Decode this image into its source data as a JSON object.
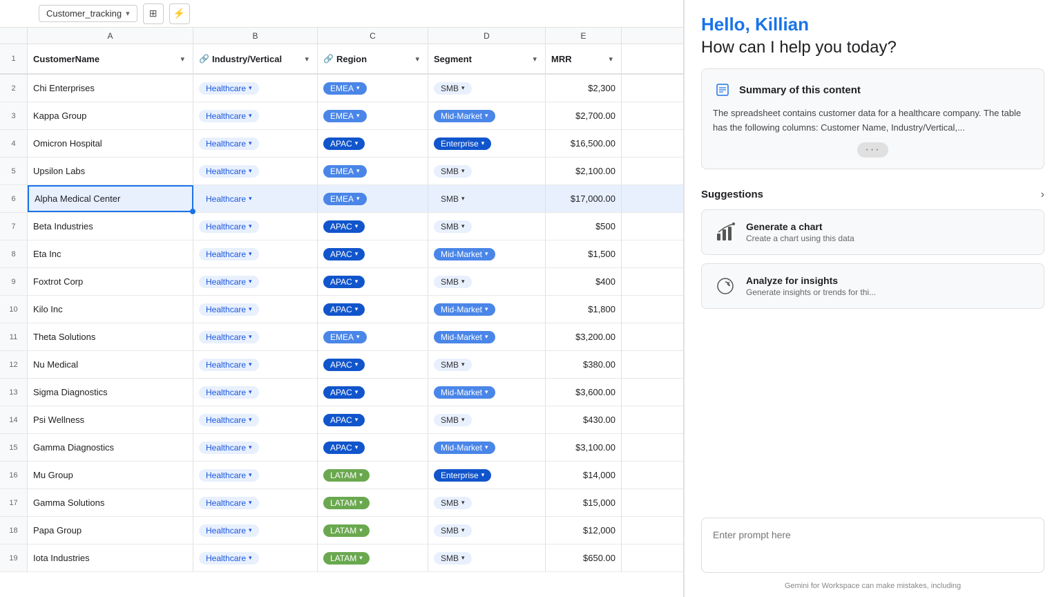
{
  "spreadsheet": {
    "sheet_name": "Customer_tracking",
    "columns": {
      "a": "A",
      "b": "B",
      "c": "C",
      "d": "D",
      "e": "E"
    },
    "headers": {
      "customer_name": "CustomerName",
      "industry": "Industry/Vertical",
      "region": "Region",
      "segment": "Segment",
      "mrr": "MRR"
    },
    "rows": [
      {
        "num": 2,
        "name": "Chi Enterprises",
        "industry": "Healthcare",
        "region": "EMEA",
        "region_type": "emea",
        "segment": "SMB",
        "segment_type": "smb",
        "mrr": "$2,300",
        "selected": false
      },
      {
        "num": 3,
        "name": "Kappa Group",
        "industry": "Healthcare",
        "region": "EMEA",
        "region_type": "emea",
        "segment": "Mid-Market",
        "segment_type": "midmarket",
        "mrr": "$2,700.00",
        "selected": false
      },
      {
        "num": 4,
        "name": "Omicron Hospital",
        "industry": "Healthcare",
        "region": "APAC",
        "region_type": "apac",
        "segment": "Enterprise",
        "segment_type": "enterprise",
        "mrr": "$16,500.00",
        "selected": false
      },
      {
        "num": 5,
        "name": "Upsilon Labs",
        "industry": "Healthcare",
        "region": "EMEA",
        "region_type": "emea",
        "segment": "SMB",
        "segment_type": "smb",
        "mrr": "$2,100.00",
        "selected": false
      },
      {
        "num": 6,
        "name": "Alpha Medical Center",
        "industry": "Healthcare",
        "region": "EMEA",
        "region_type": "emea",
        "segment": "SMB",
        "segment_type": "smb",
        "mrr": "$17,000.00",
        "selected": true
      },
      {
        "num": 7,
        "name": "Beta Industries",
        "industry": "Healthcare",
        "region": "APAC",
        "region_type": "apac",
        "segment": "SMB",
        "segment_type": "smb",
        "mrr": "$500",
        "selected": false
      },
      {
        "num": 8,
        "name": "Eta Inc",
        "industry": "Healthcare",
        "region": "APAC",
        "region_type": "apac",
        "segment": "Mid-Market",
        "segment_type": "midmarket",
        "mrr": "$1,500",
        "selected": false
      },
      {
        "num": 9,
        "name": "Foxtrot Corp",
        "industry": "Healthcare",
        "region": "APAC",
        "region_type": "apac",
        "segment": "SMB",
        "segment_type": "smb",
        "mrr": "$400",
        "selected": false
      },
      {
        "num": 10,
        "name": "Kilo Inc",
        "industry": "Healthcare",
        "region": "APAC",
        "region_type": "apac",
        "segment": "Mid-Market",
        "segment_type": "midmarket",
        "mrr": "$1,800",
        "selected": false
      },
      {
        "num": 11,
        "name": "Theta Solutions",
        "industry": "Healthcare",
        "region": "EMEA",
        "region_type": "emea",
        "segment": "Mid-Market",
        "segment_type": "midmarket",
        "mrr": "$3,200.00",
        "selected": false
      },
      {
        "num": 12,
        "name": "Nu Medical",
        "industry": "Healthcare",
        "region": "APAC",
        "region_type": "apac",
        "segment": "SMB",
        "segment_type": "smb",
        "mrr": "$380.00",
        "selected": false
      },
      {
        "num": 13,
        "name": "Sigma Diagnostics",
        "industry": "Healthcare",
        "region": "APAC",
        "region_type": "apac",
        "segment": "Mid-Market",
        "segment_type": "midmarket",
        "mrr": "$3,600.00",
        "selected": false
      },
      {
        "num": 14,
        "name": "Psi Wellness",
        "industry": "Healthcare",
        "region": "APAC",
        "region_type": "apac",
        "segment": "SMB",
        "segment_type": "smb",
        "mrr": "$430.00",
        "selected": false
      },
      {
        "num": 15,
        "name": "Gamma Diagnostics",
        "industry": "Healthcare",
        "region": "APAC",
        "region_type": "apac",
        "segment": "Mid-Market",
        "segment_type": "midmarket",
        "mrr": "$3,100.00",
        "selected": false
      },
      {
        "num": 16,
        "name": "Mu Group",
        "industry": "Healthcare",
        "region": "LATAM",
        "region_type": "latam",
        "segment": "Enterprise",
        "segment_type": "enterprise",
        "mrr": "$14,000",
        "selected": false
      },
      {
        "num": 17,
        "name": "Gamma Solutions",
        "industry": "Healthcare",
        "region": "LATAM",
        "region_type": "latam",
        "segment": "SMB",
        "segment_type": "smb",
        "mrr": "$15,000",
        "selected": false
      },
      {
        "num": 18,
        "name": "Papa Group",
        "industry": "Healthcare",
        "region": "LATAM",
        "region_type": "latam",
        "segment": "SMB",
        "segment_type": "smb",
        "mrr": "$12,000",
        "selected": false
      },
      {
        "num": 19,
        "name": "Iota Industries",
        "industry": "Healthcare",
        "region": "LATAM",
        "region_type": "latam",
        "segment": "SMB",
        "segment_type": "smb",
        "mrr": "$650.00",
        "selected": false
      }
    ]
  },
  "toolbar": {
    "sheet_name": "Customer_tracking",
    "chevron": "▾",
    "grid_icon": "⊞",
    "flash_icon": "⚡"
  },
  "ai_panel": {
    "greeting": "Hello, Killian",
    "subgreeting": "How can I help you today?",
    "summary": {
      "icon": "📋",
      "title": "Summary of this content",
      "text": "The spreadsheet contains customer data for a healthcare company. The table has the following columns: Customer Name, Industry/Vertical,...",
      "ellipsis": "···"
    },
    "suggestions_label": "Suggestions",
    "suggestions_arrow": "›",
    "suggestion1": {
      "icon": "📈",
      "title": "Generate a chart",
      "desc": "Create a chart using this data"
    },
    "suggestion2": {
      "icon": "🔄",
      "title": "Analyze for insights",
      "desc": "Generate insights or trends for thi..."
    },
    "input_placeholder": "Enter prompt here",
    "disclaimer": "Gemini for Workspace can make mistakes, including"
  },
  "col_letters": [
    "A",
    "B",
    "C",
    "D",
    "E"
  ]
}
